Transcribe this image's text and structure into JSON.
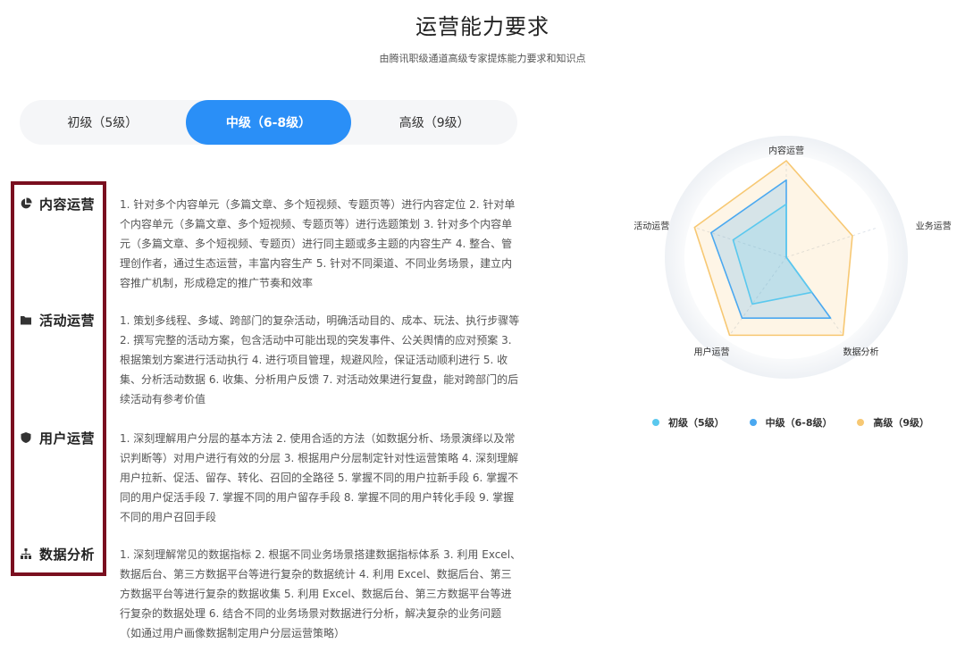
{
  "header": {
    "title": "运营能力要求",
    "subtitle": "由腾讯职级通道高级专家提炼能力要求和知识点"
  },
  "tabs": [
    {
      "label": "初级（5级）",
      "active": false
    },
    {
      "label": "中级（6-8级）",
      "active": true
    },
    {
      "label": "高级（9级）",
      "active": false
    }
  ],
  "sections": [
    {
      "label": "内容运营",
      "icon": "pie-chart-icon",
      "text": "1. 针对多个内容单元（多篇文章、多个短视频、专题页等）进行内容定位 2. 针对单个内容单元（多篇文章、多个短视频、专题页等）进行选题策划 3. 针对多个内容单元（多篇文章、多个短视频、专题页）进行同主题或多主题的内容生产 4. 整合、管理创作者，通过生态运营，丰富内容生产 5. 针对不同渠道、不同业务场景，建立内容推广机制，形成稳定的推广节奏和效率"
    },
    {
      "label": "活动运营",
      "icon": "folder-icon",
      "text": "1. 策划多线程、多域、跨部门的复杂活动，明确活动目的、成本、玩法、执行步骤等 2. 撰写完整的活动方案，包含活动中可能出现的突发事件、公关舆情的应对预案 3. 根据策划方案进行活动执行 4. 进行项目管理，规避风险，保证活动顺利进行 5. 收集、分析活动数据 6. 收集、分析用户反馈 7. 对活动效果进行复盘，能对跨部门的后续活动有参考价值"
    },
    {
      "label": "用户运营",
      "icon": "shield-icon",
      "text": "1. 深刻理解用户分层的基本方法 2. 使用合适的方法（如数据分析、场景演绎以及常识判断等）对用户进行有效的分层 3. 根据用户分层制定针对性运营策略 4. 深刻理解用户拉新、促活、留存、转化、召回的全路径 5. 掌握不同的用户拉新手段 6. 掌握不同的用户促活手段 7. 掌握不同的用户留存手段 8. 掌握不同的用户转化手段 9. 掌握不同的用户召回手段"
    },
    {
      "label": "数据分析",
      "icon": "org-chart-icon",
      "text": "1. 深刻理解常见的数据指标 2. 根据不同业务场景搭建数据指标体系 3. 利用 Excel、数据后台、第三方数据平台等进行复杂的数据统计 4. 利用 Excel、数据后台、第三方数据平台等进行复杂的数据收集 5. 利用 Excel、数据后台、第三方数据平台等进行复杂的数据处理 6. 结合不同的业务场景对数据进行分析，解决复杂的业务问题（如通过用户画像数据制定用户分层运营策略）"
    }
  ],
  "chart_data": {
    "type": "radar",
    "axes": [
      "内容运营",
      "业务运营",
      "数据分析",
      "用户运营",
      "活动运营"
    ],
    "max": 1,
    "series": [
      {
        "name": "初级（5级）",
        "color": "#5ac8ee",
        "values": [
          0.55,
          0.0,
          0.45,
          0.6,
          0.58
        ]
      },
      {
        "name": "中级（6-8级）",
        "color": "#4aa8f0",
        "values": [
          0.8,
          0.0,
          0.78,
          0.78,
          0.82
        ]
      },
      {
        "name": "高级（9级）",
        "color": "#f7c873",
        "values": [
          1.0,
          0.72,
          1.0,
          1.0,
          1.0
        ]
      }
    ],
    "legend_position": "bottom"
  },
  "colors": {
    "accent": "#2a8ff7",
    "highlight_border": "#7a0f1f"
  }
}
